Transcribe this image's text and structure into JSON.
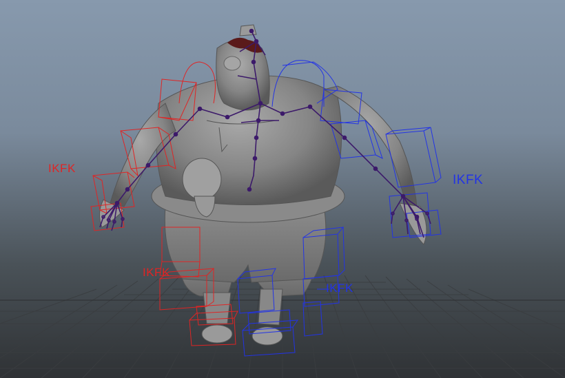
{
  "viewport": {
    "colors": {
      "grid": "#3a3d40",
      "body": "#8a8a8a",
      "ctrl_left": "#e02424",
      "ctrl_right": "#2233e6",
      "joints": "#3c1a6a"
    }
  },
  "labels": {
    "left_arm": "IKFK",
    "right_arm": "IKFK",
    "left_leg": "IKFK",
    "right_leg": "IKFK"
  }
}
